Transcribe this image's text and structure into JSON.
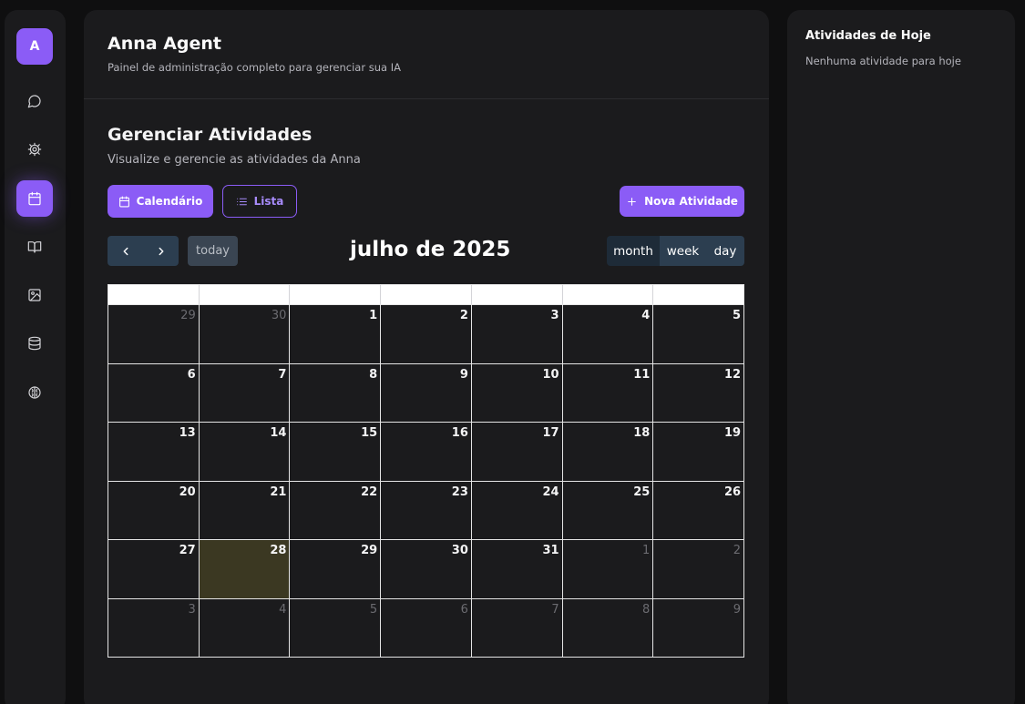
{
  "sidebar": {
    "avatar_letter": "A",
    "items": [
      {
        "icon": "chat-icon"
      },
      {
        "icon": "gear-icon"
      },
      {
        "icon": "calendar-icon",
        "active": true
      },
      {
        "icon": "book-icon"
      },
      {
        "icon": "image-icon"
      },
      {
        "icon": "database-icon"
      },
      {
        "icon": "brain-icon"
      }
    ]
  },
  "header": {
    "title": "Anna Agent",
    "subtitle": "Painel de administração completo para gerenciar sua IA"
  },
  "activities": {
    "title": "Gerenciar Atividades",
    "subtitle": "Visualize e gerencie as atividades da Anna",
    "calendar_button": "Calendário",
    "list_button": "Lista",
    "new_button": "Nova Atividade"
  },
  "calendar": {
    "today_label": "today",
    "title": "julho de 2025",
    "views": {
      "month": "month",
      "week": "week",
      "day": "day"
    },
    "weeks": [
      [
        {
          "d": "29",
          "o": 1
        },
        {
          "d": "30",
          "o": 1
        },
        {
          "d": "1"
        },
        {
          "d": "2"
        },
        {
          "d": "3"
        },
        {
          "d": "4"
        },
        {
          "d": "5"
        }
      ],
      [
        {
          "d": "6"
        },
        {
          "d": "7"
        },
        {
          "d": "8"
        },
        {
          "d": "9"
        },
        {
          "d": "10"
        },
        {
          "d": "11"
        },
        {
          "d": "12"
        }
      ],
      [
        {
          "d": "13"
        },
        {
          "d": "14"
        },
        {
          "d": "15"
        },
        {
          "d": "16"
        },
        {
          "d": "17"
        },
        {
          "d": "18"
        },
        {
          "d": "19"
        }
      ],
      [
        {
          "d": "20"
        },
        {
          "d": "21"
        },
        {
          "d": "22"
        },
        {
          "d": "23"
        },
        {
          "d": "24"
        },
        {
          "d": "25"
        },
        {
          "d": "26"
        }
      ],
      [
        {
          "d": "27"
        },
        {
          "d": "28",
          "t": 1
        },
        {
          "d": "29"
        },
        {
          "d": "30"
        },
        {
          "d": "31"
        },
        {
          "d": "1",
          "o": 1
        },
        {
          "d": "2",
          "o": 1
        }
      ],
      [
        {
          "d": "3",
          "o": 1
        },
        {
          "d": "4",
          "o": 1
        },
        {
          "d": "5",
          "o": 1
        },
        {
          "d": "6",
          "o": 1
        },
        {
          "d": "7",
          "o": 1
        },
        {
          "d": "8",
          "o": 1
        },
        {
          "d": "9",
          "o": 1
        }
      ]
    ]
  },
  "today_panel": {
    "title": "Atividades de Hoje",
    "empty": "Nenhuma atividade para hoje"
  }
}
